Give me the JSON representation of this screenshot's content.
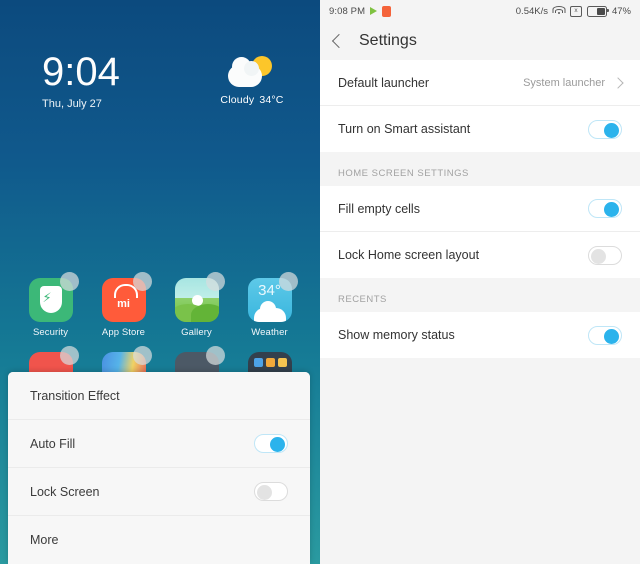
{
  "home": {
    "clock": {
      "time": "9:04",
      "date": "Thu, July 27"
    },
    "weather": {
      "condition": "Cloudy",
      "temperature": "34°C",
      "icon": "sun-behind-cloud-icon"
    },
    "apps_row1": [
      {
        "label": "Security",
        "icon": "security-shield-icon"
      },
      {
        "label": "App Store",
        "icon": "mi-app-store-icon"
      },
      {
        "label": "Gallery",
        "icon": "gallery-landscape-icon"
      },
      {
        "label": "Weather",
        "icon": "weather-34-icon"
      }
    ],
    "apps_row2": [
      {
        "label": "",
        "icon": "red-app-icon"
      },
      {
        "label": "",
        "icon": "gradient-app-icon"
      },
      {
        "label": "",
        "icon": "dark-app-icon"
      },
      {
        "label": "",
        "icon": "folder-icon"
      }
    ],
    "sheet": {
      "rows": [
        {
          "label": "Transition Effect",
          "type": "link"
        },
        {
          "label": "Auto Fill",
          "type": "toggle",
          "state": "on"
        },
        {
          "label": "Lock Screen",
          "type": "toggle",
          "state": "off"
        },
        {
          "label": "More",
          "type": "link"
        }
      ]
    }
  },
  "settings": {
    "statusbar": {
      "time": "9:08 PM",
      "play_icon": "play-icon",
      "notification_icon": "orange-app-notification-icon",
      "network_speed": "0.54K/s",
      "wifi_icon": "wifi-icon",
      "sim_icon": "no-sim-icon",
      "sim_glyph": "x",
      "battery_icon": "battery-icon",
      "battery_percent": "47%"
    },
    "appbar": {
      "back_icon": "back-chevron-icon",
      "title": "Settings"
    },
    "group1": [
      {
        "label": "Default launcher",
        "type": "link",
        "value": "System launcher"
      },
      {
        "label": "Turn on Smart assistant",
        "type": "toggle",
        "state": "on"
      }
    ],
    "section_home": {
      "title": "HOME SCREEN SETTINGS"
    },
    "group2": [
      {
        "label": "Fill empty cells",
        "type": "toggle",
        "state": "on"
      },
      {
        "label": "Lock Home screen layout",
        "type": "toggle",
        "state": "off"
      }
    ],
    "section_recents": {
      "title": "RECENTS"
    },
    "group3": [
      {
        "label": "Show memory status",
        "type": "toggle",
        "state": "on"
      }
    ]
  },
  "colors": {
    "accent_blue": "#2bb3ec",
    "home_gradient_top": "#0c4a7e",
    "home_gradient_bottom": "#2a9aa0",
    "settings_bg": "#f4f4f4"
  }
}
